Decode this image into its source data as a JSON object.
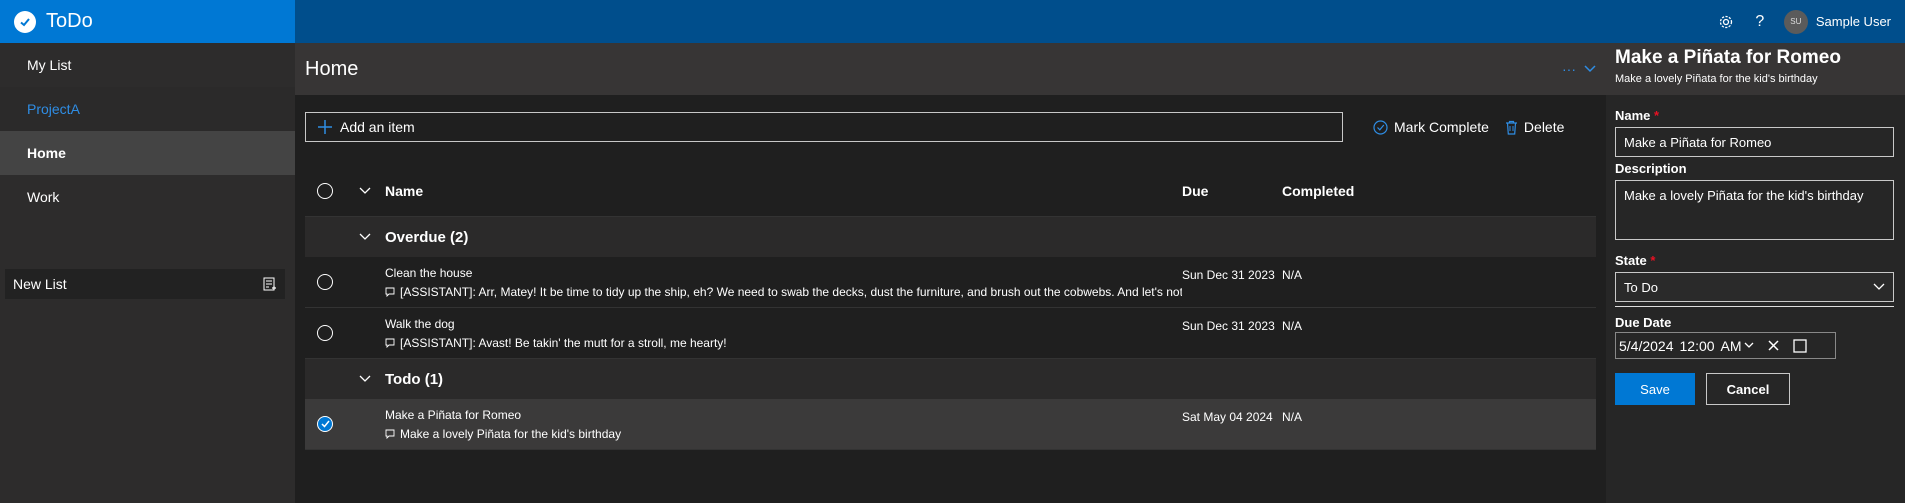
{
  "app": {
    "title": "ToDo"
  },
  "topbar": {
    "user_initials": "SU",
    "user_name": "Sample User"
  },
  "sidebar": {
    "items": [
      {
        "label": "My List"
      },
      {
        "label": "ProjectA"
      },
      {
        "label": "Home"
      },
      {
        "label": "Work"
      }
    ],
    "new_list_label": "New List"
  },
  "main": {
    "title": "Home",
    "add_item_placeholder": "Add an item",
    "mark_complete_label": "Mark Complete",
    "delete_label": "Delete",
    "columns": {
      "name": "Name",
      "due": "Due",
      "completed": "Completed"
    },
    "groups": [
      {
        "label": "Overdue (2)",
        "items": [
          {
            "name": "Clean the house",
            "note": "[ASSISTANT]: Arr, Matey! It be time to tidy up the ship, eh? We need to swab the decks, dust the furniture, and brush out the cobwebs. And let's not forget to shine the doublo...",
            "due": "Sun Dec 31 2023",
            "completed": "N/A",
            "checked": false
          },
          {
            "name": "Walk the dog",
            "note": "[ASSISTANT]: Avast! Be takin' the mutt for a stroll, me hearty!",
            "due": "Sun Dec 31 2023",
            "completed": "N/A",
            "checked": false
          }
        ]
      },
      {
        "label": "Todo (1)",
        "items": [
          {
            "name": "Make a Piñata for Romeo",
            "note": "Make a lovely Piñata for the kid's birthday",
            "due": "Sat May 04 2024",
            "completed": "N/A",
            "checked": true
          }
        ]
      }
    ]
  },
  "panel": {
    "title": "Make a Piñata for Romeo",
    "subtitle": "Make a lovely Piñata for the kid's birthday",
    "name_label": "Name",
    "name_value": "Make a Piñata for Romeo",
    "description_label": "Description",
    "description_value": "Make a lovely Piñata for the kid's birthday",
    "state_label": "State",
    "state_value": "To Do",
    "due_date_label": "Due Date",
    "due_date_value": "5/4/2024",
    "due_time_value": "12:00",
    "due_ampm_value": "AM",
    "save_label": "Save",
    "cancel_label": "Cancel"
  },
  "colors": {
    "accent": "#0078d4",
    "topbar": "#004e8c",
    "link": "#2f8de4",
    "required": "#e81123"
  }
}
